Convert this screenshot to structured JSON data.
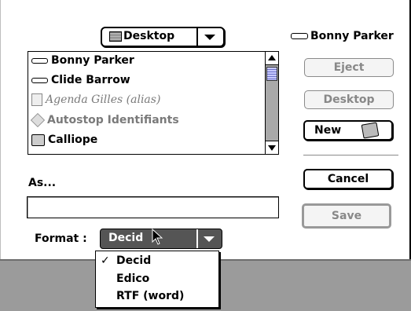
{
  "dialog": {
    "location_popup": {
      "label": "Desktop",
      "icon": "desktop-folder-icon"
    },
    "volume_label": "Bonny Parker",
    "file_list": [
      {
        "name": "Bonny Parker",
        "icon": "disk-icon",
        "style": "normal"
      },
      {
        "name": "Clide Barrow",
        "icon": "disk-icon",
        "style": "normal"
      },
      {
        "name": "Agenda Gilles (alias)",
        "icon": "document-alias-icon",
        "style": "italic-dimmed"
      },
      {
        "name": "Autostop  Identifiants",
        "icon": "application-icon",
        "style": "dimmed"
      },
      {
        "name": "Calliope",
        "icon": "folder-icon",
        "style": "normal"
      }
    ],
    "buttons": {
      "eject": "Eject",
      "desktop": "Desktop",
      "new": "New",
      "cancel": "Cancel",
      "save": "Save"
    },
    "as_label": "As...",
    "name_field_value": "",
    "format_label": "Format :",
    "format_selected": "Decid",
    "format_options": [
      {
        "label": "Decid",
        "checked": true,
        "check_mark": "✓"
      },
      {
        "label": "Edico",
        "checked": false,
        "check_mark": ""
      },
      {
        "label": "RTF (word)",
        "checked": false,
        "check_mark": ""
      }
    ]
  },
  "colors": {
    "dialog_bg": "#ffffff",
    "background_grey": "#9b9b9b",
    "popup_selected_bg": "#555555",
    "scroll_thumb": "#c7c9ff"
  }
}
